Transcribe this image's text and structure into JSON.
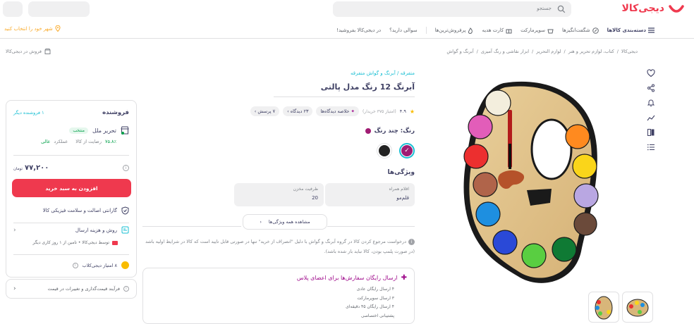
{
  "header": {
    "logo_text": "دیجی‌کالا",
    "search_placeholder": "جستجو",
    "city_label": "شهر خود را انتخاب کنید"
  },
  "nav": {
    "items": [
      {
        "label": "دسته‌بندی کالاها",
        "icon": "menu-icon"
      },
      {
        "label": "شگفت‌انگیزها",
        "icon": "percent-icon"
      },
      {
        "label": "سوپرمارکت",
        "icon": "basket-icon"
      },
      {
        "label": "کارت هدیه",
        "icon": "gift-icon"
      },
      {
        "label": "پرفروش‌ترین‌ها",
        "icon": "fire-icon"
      },
      {
        "label": "سوالی دارید؟"
      },
      {
        "label": "در دیجی‌کالا بفروشید!"
      }
    ]
  },
  "breadcrumb": [
    "دیجی‌کالا",
    "کتاب، لوازم تحریر و هنر",
    "لوازم التحریر",
    "ابزار نقاشی و رنگ آمیزی",
    "آبرنگ و گواش"
  ],
  "sell_on": "فروش در دیجی‌کالا",
  "product": {
    "category": "متفرقه / آبرنگ و گواش متفرقه",
    "title": "آبرنگ 12 رنگ مدل پالتی",
    "rating": "۴.۹",
    "rating_count": "(امتیاز ۳۷۵ خریدار)",
    "insight_chip": "خلاصه دیدگاه‌ها",
    "comments_chip": "۲۳ دیدگاه",
    "questions_chip": "۷ پرسش",
    "color_label": "رنگ: چند رنگ",
    "features_heading": "ویژگی‌ها",
    "features": [
      {
        "key": "اقلام همراه",
        "value": "قلم‌مو"
      },
      {
        "key": "ظرفیت مخزن",
        "value": "20"
      }
    ],
    "all_features_button": "مشاهده همه ویژگی‌ها",
    "note": "درخواست مرجوع کردن کالا در گروه آبرنگ و گواش با دلیل \"انصراف از خرید\" تنها در صورتی قابل تایید است که کالا در شرایط اولیه باشد (در صورت پلمپ بودن، کالا نباید باز شده باشد).",
    "colors": [
      "#a01c73",
      "#222222"
    ]
  },
  "plus": {
    "heading": "ارسال رایگان سفارش‌ها برای اعضای پلاس",
    "items": [
      "۴ ارسال رایگان عادی",
      "۳ ارسال سوپرمارکت",
      "۴ ارسال رایگان ۴۵ دقیقه‌ای",
      "پشتیبانی اختصاصی"
    ]
  },
  "seller": {
    "heading": "فروشنده",
    "other_sellers": "۱ فروشنده دیگر",
    "name": "تحریر ملل",
    "badge": "منتخب",
    "satisfaction": "۷۵.۸٪",
    "satisfaction_label": "رضایت از کالا",
    "performance_label": "عملکرد",
    "performance_value": "عالی",
    "price": "۷۷,۲۰۰",
    "currency": "تومان",
    "add_to_cart": "افزودن به سبد خرید",
    "guarantee": "گارانتی اصالت و سلامت فیزیکی کالا",
    "shipping_heading": "روش و هزینه ارسال",
    "shipping_detail": "توسط دیجی‌کالا • تامین از ۱ روز کاری دیگر",
    "points": "۸ امتیاز دیجی‌کلاب",
    "price_inquiry": "فرآیند قیمت‌گذاری و تغییرات در قیمت"
  }
}
